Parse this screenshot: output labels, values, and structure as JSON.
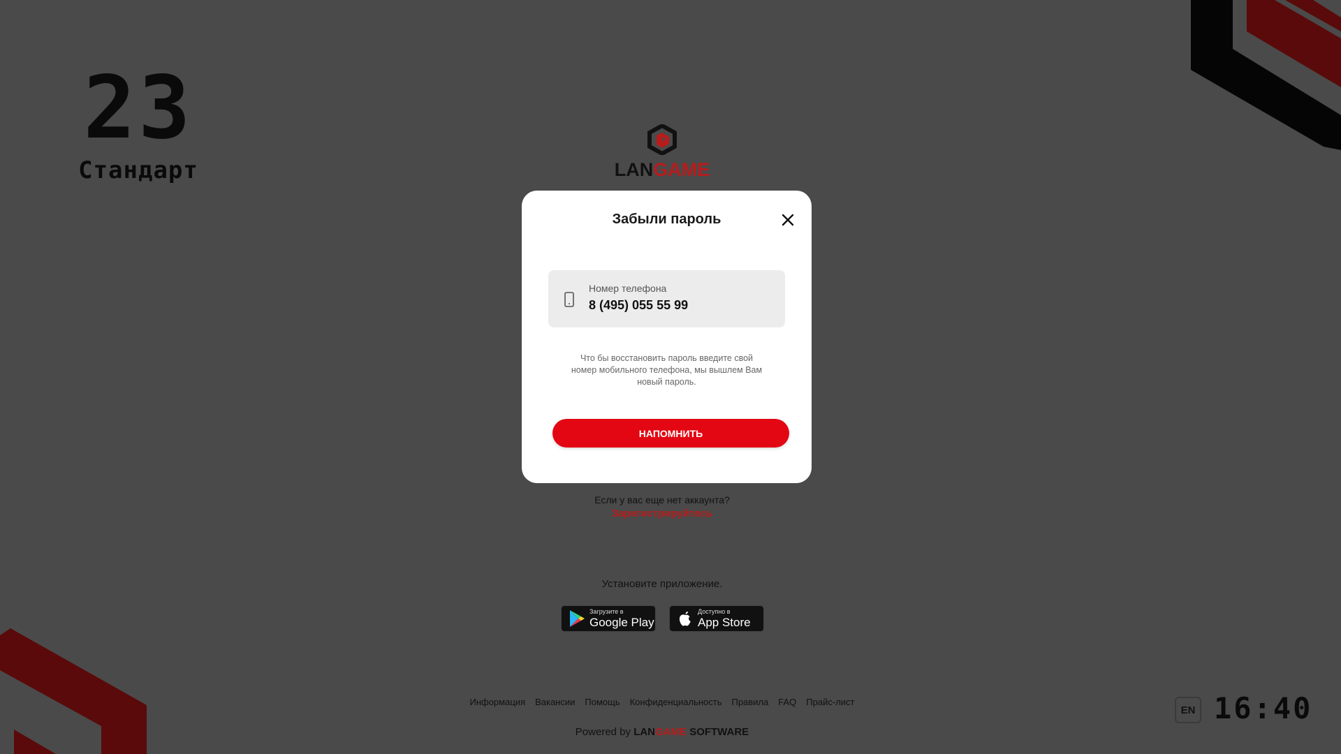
{
  "station": {
    "number": "23",
    "tariff": "Стандарт"
  },
  "logo": {
    "text_lan": "LAN",
    "text_game": "GAME"
  },
  "modal": {
    "title": "Забыли пароль",
    "phone_label": "Номер телефона",
    "phone_value": "8 (495) 055 55 99",
    "hint": "Что бы восстановить пароль введите свой номер мобильного телефона, мы вышлем Вам новый пароль.",
    "submit_label": "НАПОМНИТЬ"
  },
  "account": {
    "no_account_text": "Если у вас еще нет аккаунта?",
    "register_label": "Зарегистрируйтесь"
  },
  "apps": {
    "install_text": "Установите приложение.",
    "google_play": {
      "small": "Загрузите в",
      "big": "Google Play"
    },
    "app_store": {
      "small": "Доступно в",
      "big": "App Store"
    }
  },
  "footer": {
    "links": [
      "Информация",
      "Вакансии",
      "Помощь",
      "Конфиденциальность",
      "Правила",
      "FAQ",
      "Прайс-лист"
    ],
    "powered_prefix": "Powered by",
    "powered_lan": "LAN",
    "powered_game": "GAME",
    "powered_software": "SOFTWARE"
  },
  "language_button": "EN",
  "clock": "16:40",
  "colors": {
    "background": "#4a4a4a",
    "accent_red": "#e30613",
    "brand_dark_red": "#b71c1c",
    "modal_bg": "#ffffff",
    "field_bg": "#ececec"
  }
}
